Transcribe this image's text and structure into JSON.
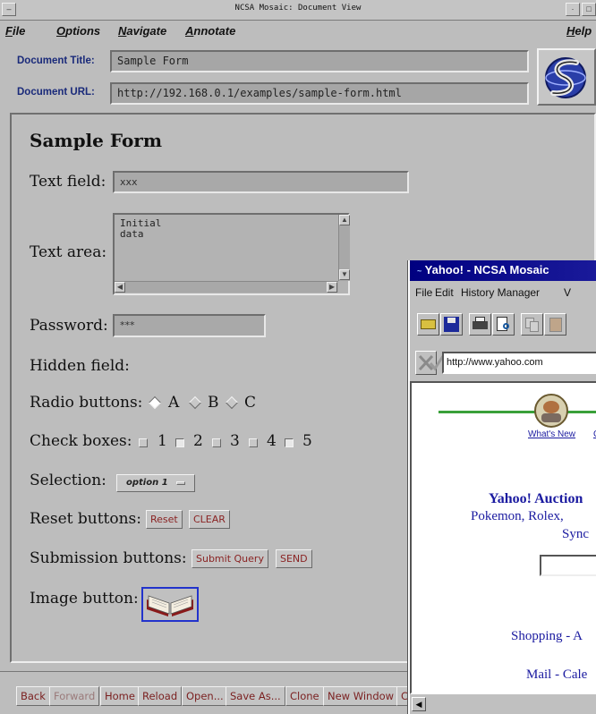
{
  "mosaic": {
    "window_title": "NCSA Mosaic: Document View",
    "menu": [
      "File",
      "Options",
      "Navigate",
      "Annotate"
    ],
    "help": "Help",
    "doc_title_label": "Document Title:",
    "doc_title_value": "Sample Form",
    "doc_url_label": "Document URL:",
    "doc_url_value": "http://192.168.0.1/examples/sample-form.html",
    "form": {
      "heading": "Sample Form",
      "text_field_label": "Text field:",
      "text_field_value": "xxx",
      "text_area_label": "Text area:",
      "text_area_value": "Initial\ndata",
      "password_label": "Password:",
      "password_value": "***",
      "hidden_field_label": "Hidden field:",
      "radio_label": "Radio buttons:",
      "radio_options": [
        "A",
        "B",
        "C"
      ],
      "radio_selected": "A",
      "checkbox_label": "Check boxes:",
      "checkbox_options": [
        "1",
        "2",
        "3",
        "4",
        "5"
      ],
      "selection_label": "Selection:",
      "selection_value": "option 1",
      "reset_label": "Reset buttons:",
      "reset_buttons": [
        "Reset",
        "CLEAR"
      ],
      "submission_label": "Submission buttons:",
      "submission_buttons": [
        "Submit Query",
        "SEND"
      ],
      "image_button_label": "Image button:"
    },
    "bottom_buttons": [
      "Back",
      "Forward",
      "Home",
      "Reload",
      "Open...",
      "Save As...",
      "Clone",
      "New Window",
      "C"
    ]
  },
  "yahoo": {
    "window_title": "Yahoo! - NCSA Mosaic",
    "menu": [
      "File",
      "Edit",
      "History Manager",
      "V"
    ],
    "url": "http://www.yahoo.com",
    "whats_new": "What's New",
    "whats_new_trail": "C",
    "auctions": "Yahoo! Auction",
    "auctions_line2": "Pokemon, Rolex,",
    "auctions_line3": "Sync",
    "shopping": "Shopping - A",
    "mail": "Mail - Cale"
  }
}
